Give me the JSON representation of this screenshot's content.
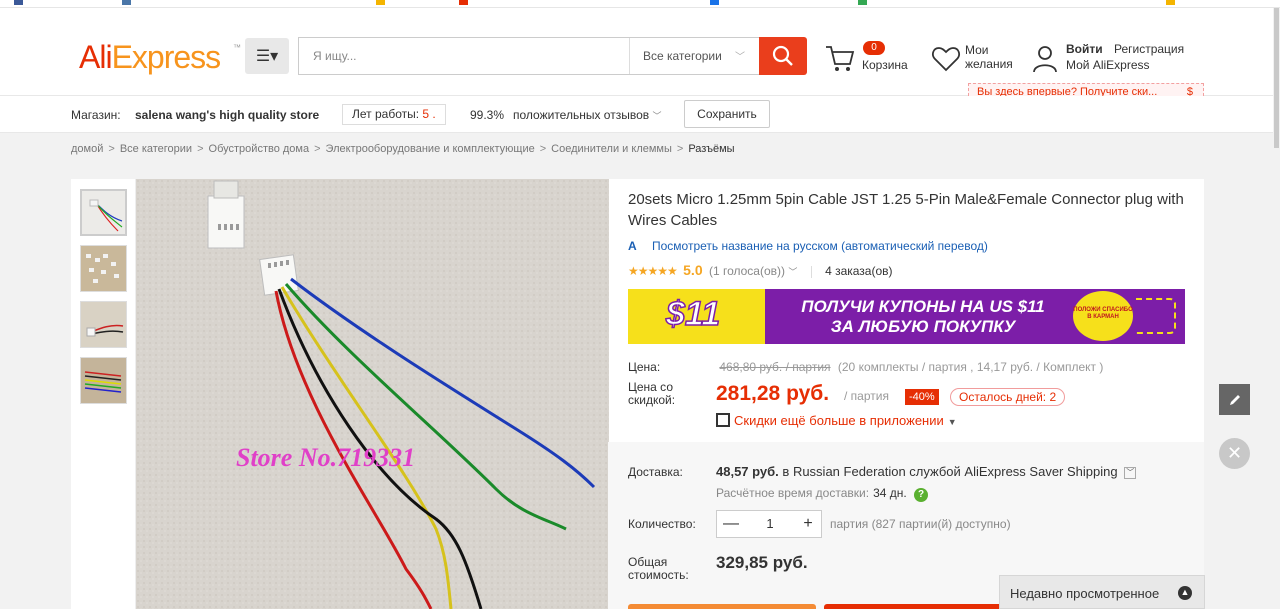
{
  "header": {
    "logo_part1": "Ali",
    "logo_part2": "Express",
    "logo_tm": "™",
    "search_placeholder": "Я ищу...",
    "search_category": "Все категории",
    "cart_count": "0",
    "cart_label": "Корзина",
    "wishlist_label": "Мои желания",
    "login_label": "Войти",
    "register_label": "Регистрация",
    "my_account_label": "Мой AliExpress",
    "promo_text": "Вы здесь впервые? Получите ски...",
    "promo_icon": "$"
  },
  "store": {
    "label": "Магазин:",
    "name": "salena wang's high quality store",
    "years_label": "Лет работы:",
    "years_value": "5 .",
    "positive_pct": "99.3%",
    "positive_label": "положительных отзывов",
    "save_label": "Сохранить"
  },
  "breadcrumb": [
    "домой",
    "Все категории",
    "Обустройство дома",
    "Электрооборудование и комплектующие",
    "Соединители и клеммы",
    "Разъёмы"
  ],
  "breadcrumb_sep": ">",
  "product": {
    "title": "20sets Micro 1.25mm 5pin Cable JST 1.25 5-Pin Male&Female Connector plug with Wires Cables",
    "translate_icon": "A ",
    "translate_link": "Посмотреть название на русском (автоматический перевод)",
    "stars": "★★★★★",
    "rating": "5.0",
    "votes": "(1 голоса(ов))",
    "orders": "4 заказа(ов)",
    "image_watermark": "Store No.719331",
    "banner": {
      "amount": "$11",
      "text": "ПОЛУЧИ КУПОНЫ НА US $11 ЗА ЛЮБУЮ ПОКУПКУ",
      "badge": "ПОЛОЖИ СПАСИБО В КАРМАН",
      "colors": {
        "background": "#7c1ea8",
        "accent": "#f6e01b"
      }
    },
    "price_label": "Цена:",
    "old_price": "468,80 руб. / партия",
    "old_price_details": "(20 комплекты / партия , 14,17 руб. / Комплект )",
    "discount_label": "Цена со скидкой:",
    "new_price": "281,28 руб.",
    "unit": "/ партия",
    "discount": "-40%",
    "days_left": "Осталось дней: 2",
    "app_discount": "Скидки ещё больше в приложении",
    "shipping_label": "Доставка:",
    "shipping_price": "48,57 руб.",
    "shipping_text": "в Russian Federation службой AliExpress Saver Shipping",
    "delivery_est_label": "Расчётное время доставки:",
    "delivery_days": "34 дн.",
    "quantity_label": "Количество:",
    "quantity_minus": "—",
    "quantity": "1",
    "quantity_plus": "+",
    "quantity_note": "партия (827 партии(й) доступно)",
    "total_label": "Общая стоимость:",
    "total": "329,85 руб."
  },
  "recently_viewed": "Недавно просмотренное",
  "colors": {
    "brand": "#e62e04",
    "brand_orange": "#f7941d",
    "star": "#f5a623",
    "link": "#1a5fb4"
  }
}
